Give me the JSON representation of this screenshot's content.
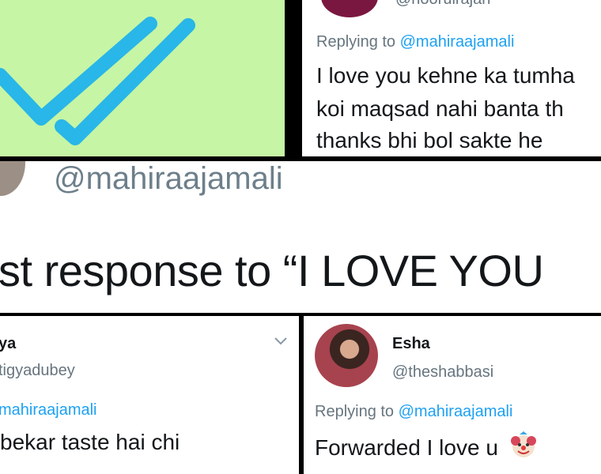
{
  "top_right": {
    "handle_partial": "@noorulrajan",
    "replying_prefix": "Replying to",
    "replying_handle": "@mahiraajamali",
    "line1": "I love you kehne ka tumha",
    "line2": "koi maqsad nahi banta th",
    "line3": "thanks bhi bol sakte he"
  },
  "middle": {
    "handle": "@mahiraajamali",
    "headline": "st response to “I LOVE YOU"
  },
  "bottom_left": {
    "name_partial": "ya",
    "handle_partial": "tigyadubey",
    "replying_handle_partial": "mahiraajamali",
    "tweet_text": "bekar taste hai chi"
  },
  "bottom_right": {
    "name": "Esha",
    "handle": "@theshabbasi",
    "replying_prefix": "Replying to",
    "replying_handle": "@mahiraajamali",
    "tweet_text": "Forwarded I love u"
  },
  "icons": [
    "double-check-icon",
    "chevron-down-icon",
    "clown-emoji-icon"
  ],
  "colors": {
    "accent": "#1da1f2",
    "green_bg": "#c6f5a5",
    "check_blue": "#29b6e8"
  }
}
